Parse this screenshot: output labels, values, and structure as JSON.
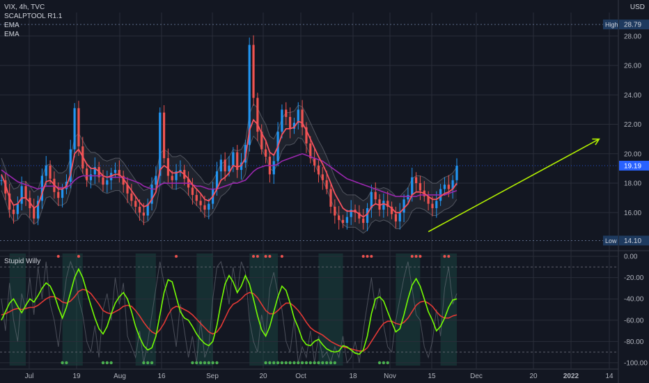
{
  "header": {
    "symbol": "VIX, 4h, TVC",
    "indicators": [
      "SCALPTOOL R1.1",
      "EMA",
      "EMA"
    ],
    "currency": "USD"
  },
  "lower_pane": {
    "title": "Stupid Willy"
  },
  "colors": {
    "background": "#131722",
    "grid": "#2a2e39",
    "candle_up": "#2196f3",
    "candle_down": "#ef5350",
    "ema_fast": "#f7525f",
    "ema_slow": "#9c27b0",
    "envelope": "#787b86",
    "trendline": "#b2f000",
    "current_price_bg": "#2962ff",
    "extreme_label_bg": "#1e3a5f",
    "osc_fast": "#76ff03",
    "osc_slow": "#e53935",
    "osc_raw": "#787b86",
    "osc_shade": "#1b4d47",
    "osc_dot_top": "#ef5350",
    "osc_dot_bottom": "#4caf50"
  },
  "chart_data": [
    {
      "type": "line",
      "title": "VIX, 4h, TVC",
      "ylim": [
        13.6,
        29.6
      ],
      "y_ticks": [
        16.0,
        18.0,
        20.0,
        22.0,
        24.0,
        26.0,
        28.0
      ],
      "x_tick_labels": [
        "Jul",
        "19",
        "Aug",
        "16",
        "Sep",
        "20",
        "Oct",
        "18",
        "Nov",
        "15",
        "Dec",
        "20",
        "2022",
        "14"
      ],
      "current_price": 19.19,
      "high": {
        "label": "High",
        "value": 28.79
      },
      "low": {
        "label": "Low",
        "value": 14.1
      },
      "series_close": [
        18.2,
        17.3,
        16.2,
        15.9,
        16.6,
        17.8,
        17.0,
        16.3,
        15.6,
        16.8,
        18.5,
        19.2,
        18.3,
        17.4,
        17.0,
        17.6,
        18.1,
        20.3,
        23.1,
        20.5,
        19.0,
        18.2,
        18.6,
        19.1,
        18.4,
        17.9,
        18.2,
        18.7,
        18.9,
        18.5,
        17.9,
        17.3,
        16.8,
        16.4,
        16.0,
        15.8,
        16.6,
        17.9,
        18.5,
        22.8,
        19.7,
        18.5,
        18.2,
        18.8,
        18.9,
        18.3,
        17.7,
        17.2,
        16.8,
        16.5,
        16.2,
        16.6,
        17.6,
        18.8,
        19.6,
        18.8,
        19.2,
        20.1,
        18.9,
        19.4,
        20.6,
        27.4,
        23.8,
        21.5,
        20.3,
        19.8,
        18.6,
        19.5,
        21.5,
        23.0,
        22.5,
        21.7,
        22.1,
        23.0,
        21.8,
        20.7,
        19.7,
        19.2,
        18.6,
        18.2,
        17.6,
        16.4,
        15.8,
        15.5,
        15.3,
        15.7,
        16.2,
        16.0,
        15.6,
        15.3,
        16.3,
        17.4,
        16.9,
        16.2,
        16.8,
        16.4,
        15.9,
        15.4,
        16.0,
        16.9,
        17.2,
        18.4,
        18.0,
        17.5,
        17.1,
        16.6,
        16.3,
        16.8,
        17.6,
        17.9,
        17.6,
        18.2,
        19.19
      ],
      "ema_fast": [
        18.6,
        17.9,
        17.0,
        16.5,
        16.6,
        17.0,
        17.0,
        16.7,
        16.3,
        16.5,
        17.3,
        18.1,
        18.2,
        17.9,
        17.6,
        17.6,
        17.8,
        18.6,
        20.0,
        20.3,
        19.8,
        19.3,
        19.0,
        19.0,
        18.8,
        18.5,
        18.4,
        18.5,
        18.6,
        18.6,
        18.3,
        17.9,
        17.5,
        17.1,
        16.7,
        16.4,
        16.5,
        16.9,
        17.4,
        18.9,
        19.2,
        19.0,
        18.7,
        18.7,
        18.8,
        18.6,
        18.3,
        17.9,
        17.6,
        17.3,
        16.9,
        16.8,
        17.1,
        17.6,
        18.2,
        18.4,
        18.7,
        19.2,
        19.1,
        19.2,
        19.7,
        21.6,
        22.3,
        22.0,
        21.4,
        20.9,
        20.1,
        19.9,
        20.5,
        21.3,
        21.7,
        21.7,
        21.8,
        22.2,
        22.1,
        21.6,
        21.0,
        20.4,
        19.8,
        19.3,
        18.7,
        18.0,
        17.3,
        16.8,
        16.3,
        16.1,
        16.1,
        16.1,
        15.9,
        15.7,
        15.9,
        16.4,
        16.6,
        16.5,
        16.6,
        16.5,
        16.3,
        16.0,
        16.0,
        16.3,
        16.6,
        17.2,
        17.4,
        17.4,
        17.3,
        17.1,
        16.9,
        16.9,
        17.1,
        17.3,
        17.4,
        17.6,
        18.0
      ],
      "ema_slow": [
        18.9,
        18.7,
        18.5,
        18.3,
        18.1,
        18.0,
        17.9,
        17.8,
        17.7,
        17.6,
        17.7,
        17.8,
        17.8,
        17.8,
        17.7,
        17.7,
        17.7,
        17.9,
        18.2,
        18.4,
        18.5,
        18.5,
        18.5,
        18.5,
        18.5,
        18.5,
        18.4,
        18.4,
        18.4,
        18.4,
        18.4,
        18.3,
        18.2,
        18.1,
        18.0,
        17.8,
        17.7,
        17.6,
        17.6,
        17.9,
        18.0,
        18.0,
        18.0,
        18.0,
        18.0,
        18.0,
        18.0,
        17.9,
        17.8,
        17.8,
        17.7,
        17.6,
        17.6,
        17.6,
        17.7,
        17.8,
        17.9,
        18.0,
        18.0,
        18.1,
        18.2,
        18.5,
        18.8,
        19.0,
        19.1,
        19.2,
        19.2,
        19.2,
        19.3,
        19.5,
        19.6,
        19.7,
        19.8,
        19.9,
        20.0,
        19.9,
        19.8,
        19.7,
        19.6,
        19.5,
        19.3,
        19.1,
        18.9,
        18.7,
        18.5,
        18.3,
        18.2,
        18.1,
        18.0,
        17.9,
        17.8,
        17.7,
        17.6,
        17.5,
        17.4,
        17.3,
        17.2,
        17.1,
        17.1,
        17.1,
        17.1,
        17.1,
        17.1,
        17.2,
        17.2,
        17.2,
        17.2,
        17.2,
        17.2,
        17.2,
        17.3,
        17.4,
        17.5
      ],
      "trendline": {
        "from": [
          105,
          14.7
        ],
        "to": [
          147,
          21.0
        ]
      }
    },
    {
      "type": "line",
      "title": "Stupid Willy",
      "ylim": [
        -104,
        4
      ],
      "y_ticks": [
        0.0,
        -20.0,
        -40.0,
        -60.0,
        -80.0,
        -100.0
      ],
      "series_fast": [
        -60,
        -52,
        -44,
        -40,
        -47,
        -53,
        -46,
        -40,
        -43,
        -37,
        -30,
        -25,
        -28,
        -36,
        -48,
        -58,
        -48,
        -34,
        -20,
        -12,
        -20,
        -33,
        -46,
        -58,
        -68,
        -73,
        -66,
        -54,
        -44,
        -38,
        -34,
        -40,
        -52,
        -66,
        -76,
        -84,
        -88,
        -86,
        -75,
        -55,
        -34,
        -22,
        -24,
        -38,
        -52,
        -58,
        -60,
        -66,
        -73,
        -78,
        -82,
        -84,
        -80,
        -65,
        -44,
        -26,
        -18,
        -24,
        -34,
        -28,
        -18,
        -26,
        -40,
        -56,
        -69,
        -75,
        -66,
        -52,
        -38,
        -28,
        -32,
        -44,
        -58,
        -67,
        -78,
        -83,
        -84,
        -80,
        -78,
        -83,
        -87,
        -89,
        -90,
        -89,
        -84,
        -85,
        -88,
        -91,
        -92,
        -88,
        -75,
        -54,
        -40,
        -38,
        -42,
        -52,
        -62,
        -71,
        -68,
        -55,
        -40,
        -27,
        -21,
        -28,
        -40,
        -52,
        -60,
        -70,
        -66,
        -58,
        -48,
        -41,
        -40
      ],
      "series_slow": [
        -55,
        -54,
        -52,
        -50,
        -49,
        -50,
        -49,
        -48,
        -48,
        -46,
        -43,
        -40,
        -38,
        -38,
        -40,
        -43,
        -44,
        -42,
        -38,
        -33,
        -31,
        -32,
        -35,
        -40,
        -45,
        -51,
        -53,
        -54,
        -52,
        -50,
        -47,
        -46,
        -47,
        -51,
        -56,
        -62,
        -67,
        -71,
        -73,
        -69,
        -63,
        -55,
        -49,
        -47,
        -48,
        -50,
        -52,
        -55,
        -59,
        -63,
        -67,
        -71,
        -73,
        -71,
        -66,
        -58,
        -50,
        -45,
        -43,
        -40,
        -36,
        -34,
        -35,
        -39,
        -45,
        -51,
        -54,
        -54,
        -51,
        -47,
        -44,
        -44,
        -47,
        -51,
        -56,
        -62,
        -67,
        -70,
        -72,
        -74,
        -77,
        -80,
        -82,
        -84,
        -85,
        -86,
        -87,
        -88,
        -89,
        -89,
        -86,
        -80,
        -74,
        -68,
        -63,
        -61,
        -61,
        -63,
        -64,
        -62,
        -58,
        -52,
        -46,
        -43,
        -42,
        -44,
        -47,
        -52,
        -56,
        -58,
        -58,
        -56,
        -55
      ],
      "series_raw": [
        -40,
        -70,
        -25,
        -60,
        -80,
        -35,
        -50,
        -20,
        -55,
        -10,
        -40,
        -5,
        -45,
        -60,
        -85,
        -50,
        -20,
        -5,
        -15,
        -40,
        -55,
        -80,
        -90,
        -65,
        -95,
        -50,
        -35,
        -60,
        -20,
        -45,
        -25,
        -75,
        -85,
        -95,
        -70,
        -100,
        -80,
        -55,
        -30,
        -5,
        -25,
        -40,
        -60,
        -85,
        -45,
        -70,
        -95,
        -75,
        -100,
        -60,
        -95,
        -85,
        -40,
        -10,
        -5,
        -20,
        -45,
        -10,
        -35,
        -5,
        -15,
        -60,
        -80,
        -90,
        -55,
        -75,
        -30,
        -15,
        -35,
        -50,
        -80,
        -90,
        -60,
        -100,
        -85,
        -95,
        -70,
        -100,
        -75,
        -95,
        -90,
        -100,
        -85,
        -95,
        -75,
        -100,
        -95,
        -80,
        -100,
        -70,
        -45,
        -20,
        -50,
        -30,
        -65,
        -85,
        -90,
        -60,
        -40,
        -20,
        -5,
        -30,
        -55,
        -60,
        -85,
        -95,
        -80,
        -50,
        -75,
        -30,
        -10,
        -45,
        -35
      ],
      "overbought_marks": [
        14,
        19,
        43,
        62,
        63,
        65,
        66,
        69,
        89,
        90,
        91,
        101,
        102,
        103,
        109,
        110
      ],
      "oversold_marks": [
        15,
        16,
        25,
        26,
        27,
        35,
        36,
        37,
        47,
        48,
        49,
        50,
        51,
        52,
        53,
        65,
        66,
        67,
        68,
        69,
        70,
        71,
        72,
        73,
        74,
        75,
        76,
        77,
        78,
        79,
        80,
        81,
        82,
        93,
        94,
        95
      ],
      "shaded_spans": [
        [
          2,
          6
        ],
        [
          15,
          20
        ],
        [
          33,
          38
        ],
        [
          48,
          52
        ],
        [
          61,
          68
        ],
        [
          78,
          84
        ],
        [
          97,
          103
        ],
        [
          108,
          112
        ]
      ]
    }
  ]
}
